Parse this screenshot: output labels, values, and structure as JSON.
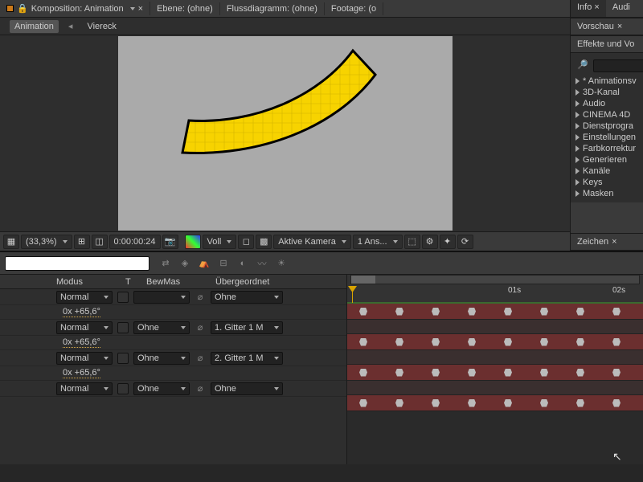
{
  "top_tabs": {
    "info": "Info",
    "audio": "Audi"
  },
  "comp_header": {
    "title": "Komposition: Animation",
    "layer_tab": "Ebene: (ohne)",
    "flow_tab": "Flussdiagramm: (ohne)",
    "footage_tab": "Footage: (o"
  },
  "breadcrumb": {
    "current": "Animation",
    "parent": "Viereck"
  },
  "viewer_toolbar": {
    "zoom": "(33,3%)",
    "time": "0:00:00:24",
    "res": "Voll",
    "camera": "Aktive Kamera",
    "views": "1 Ans..."
  },
  "side": {
    "preview": "Vorschau",
    "effects_title": "Effekte und Vo",
    "search_placeholder": "",
    "zeichen": "Zeichen",
    "categories": [
      "* Animationsv",
      "3D-Kanal",
      "Audio",
      "CINEMA 4D",
      "Dienstprogra",
      "Einstellungen",
      "Farbkorrektur",
      "Generieren",
      "Kanäle",
      "Keys",
      "Masken"
    ]
  },
  "timeline": {
    "headers": {
      "mode": "Modus",
      "t": "T",
      "bewmas": "BewMas",
      "parent": "Übergeordnet"
    },
    "ruler_labels": [
      "01s",
      "02s"
    ],
    "rows": [
      {
        "mode": "Normal",
        "mask": "",
        "parent": "Ohne",
        "value": "0x +65,6°"
      },
      {
        "mode": "Normal",
        "mask": "Ohne",
        "parent": "1. Gitter 1 M",
        "value": "0x +65,6°"
      },
      {
        "mode": "Normal",
        "mask": "Ohne",
        "parent": "2. Gitter 1 M",
        "value": "0x +65,6°"
      },
      {
        "mode": "Normal",
        "mask": "Ohne",
        "parent": "Ohne",
        "value": ""
      }
    ],
    "keyframe_positions": [
      10,
      55,
      100,
      145,
      190,
      235,
      280,
      325
    ]
  }
}
